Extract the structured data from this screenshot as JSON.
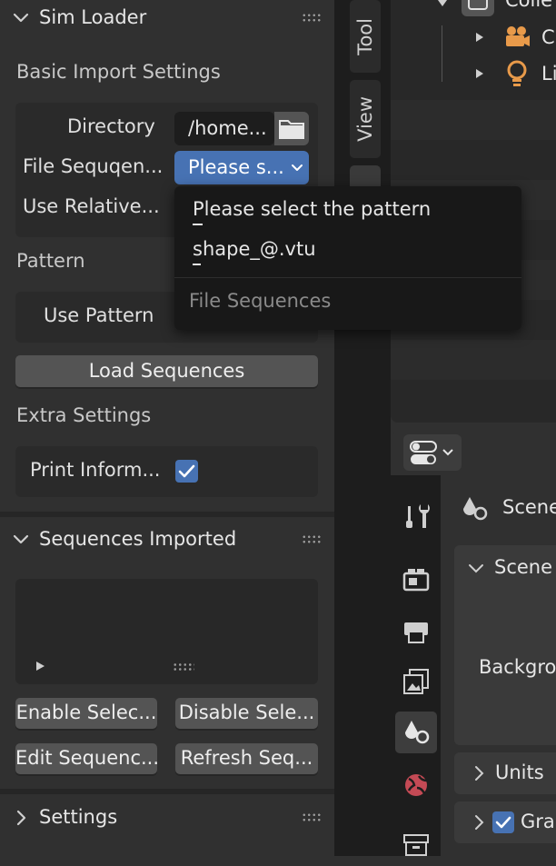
{
  "sidebar": {
    "sim_loader": {
      "title": "Sim Loader",
      "basic_import_label": "Basic Import Settings",
      "directory_label": "Directory",
      "directory_value": "/home...",
      "file_sequence_label": "File Sequqen...",
      "file_sequence_value": "Please s...",
      "use_relative_label": "Use Relative...",
      "pattern_label": "Pattern",
      "use_pattern_label": "Use Pattern",
      "load_button": "Load Sequences",
      "extra_settings_label": "Extra Settings",
      "print_info_label": "Print Inform...",
      "print_info_checked": true
    },
    "sequences_imported": {
      "title": "Sequences Imported",
      "buttons": [
        "Enable Selec...",
        "Disable Sele...",
        "Edit Sequenc...",
        "Refresh Seq..."
      ]
    },
    "settings": {
      "title": "Settings"
    }
  },
  "dropdown_menu": {
    "items": [
      "Please select the pattern",
      "shape_@.vtu"
    ],
    "header": "File Sequences"
  },
  "tabs": [
    "Tool",
    "View"
  ],
  "outliner": {
    "root": "Colle",
    "children": [
      "C",
      "Li"
    ]
  },
  "properties": {
    "context_title": "Scene",
    "scene_panel": "Scene",
    "background_label": "Backgro",
    "units_panel": "Units",
    "gravity_panel": "Gra",
    "gravity_checked": true
  },
  "colors": {
    "accent": "#4772b3",
    "panel_bg": "#303030",
    "field_bg": "#1d1d1d"
  }
}
